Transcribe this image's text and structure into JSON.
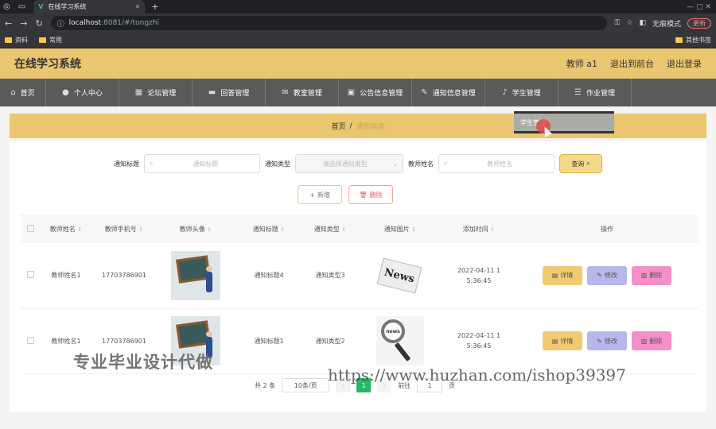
{
  "browser": {
    "tab_title": "在线学习系统",
    "url_host": "localhost",
    "url_path": ":8081/#/tongzhi",
    "incognito_label": "无痕模式",
    "update_label": "更新",
    "bookmarks": [
      "资料",
      "常用"
    ],
    "other_bookmarks": "其他书签"
  },
  "header": {
    "title": "在线学习系统",
    "user": "教师 a1",
    "back_front": "退出到前台",
    "logout": "退出登录"
  },
  "nav": [
    {
      "label": "首页",
      "icon": "home-icon"
    },
    {
      "label": "个人中心",
      "icon": "user-icon"
    },
    {
      "label": "论坛管理",
      "icon": "grid-icon"
    },
    {
      "label": "回答管理",
      "icon": "chat-icon"
    },
    {
      "label": "教室管理",
      "icon": "mail-icon"
    },
    {
      "label": "公告信息管理",
      "icon": "image-icon"
    },
    {
      "label": "通知信息管理",
      "icon": "edit-icon"
    },
    {
      "label": "学生管理",
      "icon": "mic-icon"
    },
    {
      "label": "作业管理",
      "icon": "sliders-icon"
    }
  ],
  "dropdown": {
    "item": "学生管理"
  },
  "breadcrumb": {
    "home": "首页",
    "sep": "/",
    "current": "通知信息"
  },
  "search": {
    "title_label": "通知标题",
    "title_placeholder": "通知标题",
    "type_label": "通知类型",
    "type_placeholder": "请选择通知类型",
    "name_label": "教师姓名",
    "name_placeholder": "教师姓名",
    "query_label": "查询"
  },
  "actions": {
    "add": "新增",
    "delete": "删除"
  },
  "table": {
    "headers": [
      "教师姓名",
      "教师手机号",
      "教师头像",
      "通知标题",
      "通知类型",
      "通知图片",
      "添加时间",
      "操作"
    ],
    "rows": [
      {
        "name": "教师姓名1",
        "phone": "17703786901",
        "title": "通知标题4",
        "type": "通知类型3",
        "time_a": "2022-04-11 1",
        "time_b": "5:36:45",
        "news_text": "News"
      },
      {
        "name": "教师姓名1",
        "phone": "17703786901",
        "title": "通知标题1",
        "type": "通知类型2",
        "time_a": "2022-04-11 1",
        "time_b": "5:36:45",
        "news_text": "news"
      }
    ],
    "op_detail": "详情",
    "op_edit": "修改",
    "op_delete": "删除"
  },
  "pager": {
    "total": "共 2 条",
    "size": "10条/页",
    "page": "1",
    "goto": "前往",
    "goto_value": "1",
    "page_suffix": "页"
  },
  "watermark": {
    "text": "专业毕业设计代做",
    "url": "https://www.huzhan.com/ishop39397"
  }
}
